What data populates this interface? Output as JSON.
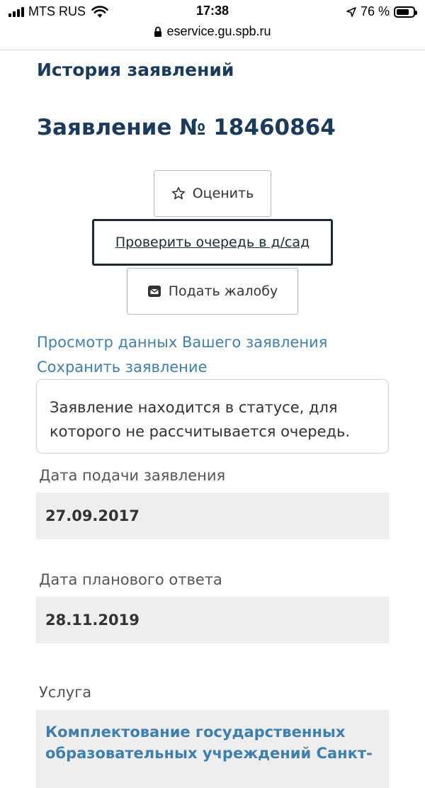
{
  "status_bar": {
    "carrier": "MTS RUS",
    "time": "17:38",
    "battery_percent": "76 %",
    "battery_level": 0.76
  },
  "browser": {
    "url": "eservice.gu.spb.ru"
  },
  "page": {
    "heading": "История заявлений",
    "application_title": "Заявление № 18460864"
  },
  "actions": {
    "rate_label": "Оценить",
    "check_queue_label": "Проверить очередь в д/сад",
    "complaint_label": "Подать жалобу"
  },
  "links": {
    "view_data": "Просмотр данных Вашего заявления",
    "save_application": "Сохранить заявление"
  },
  "status_message": "Заявление находится в статусе, для которого не рассчитывается очередь.",
  "fields": {
    "submit_date_label": "Дата подачи заявления",
    "submit_date_value": "27.09.2017",
    "planned_answer_label": "Дата планового ответа",
    "planned_answer_value": "28.11.2019",
    "service_label": "Услуга",
    "service_value": "Комплектование государственных образовательных учреждений Санкт-"
  },
  "colors": {
    "heading": "#1b3b5c",
    "link": "#3f7faf",
    "field_bg": "#eeeeee",
    "primary_border": "#1b2a36"
  }
}
